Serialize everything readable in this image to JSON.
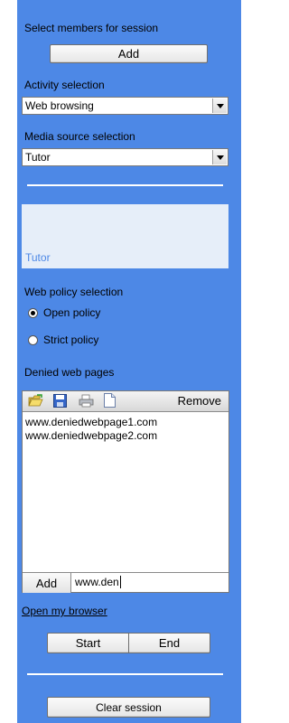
{
  "members": {
    "title": "Select members for session",
    "add_label": "Add"
  },
  "activity": {
    "title": "Activity selection",
    "value": "Web browsing"
  },
  "media": {
    "title": "Media source selection",
    "value": "Tutor"
  },
  "preview": {
    "label": "Tutor"
  },
  "policy": {
    "title": "Web policy selection",
    "options": [
      {
        "label": "Open policy",
        "selected": true
      },
      {
        "label": "Strict policy",
        "selected": false
      }
    ]
  },
  "denied": {
    "title": "Denied web pages",
    "remove_label": "Remove",
    "items": [
      "www.deniedwebpage1.com",
      "www.deniedwebpage2.com"
    ],
    "add_label": "Add",
    "input_value": "www.den"
  },
  "browser_link": "Open my browser",
  "controls": {
    "start_label": "Start",
    "end_label": "End"
  },
  "clear_label": "Clear session",
  "icons": [
    "open-folder-icon",
    "save-icon",
    "print-icon",
    "new-document-icon",
    "dropdown-arrow-icon"
  ]
}
